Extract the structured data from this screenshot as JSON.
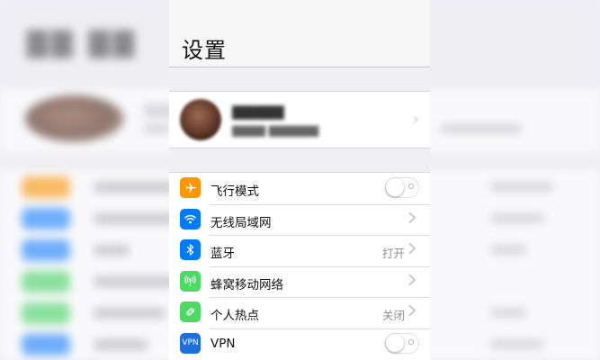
{
  "nav": {
    "title": "设置"
  },
  "colors": {
    "airplane": "#ff9500",
    "wifi": "#007aff",
    "bluetooth": "#007aff",
    "cellular": "#4cd964",
    "hotspot": "#4cd964",
    "vpn": "#1e6fd9",
    "toggle_off": "#ffffff",
    "value_text": "#8e8e93"
  },
  "settings": [
    {
      "label": "飞行模式",
      "icon": "airplane-icon",
      "control": "toggle",
      "on": false
    },
    {
      "label": "无线局域网",
      "icon": "wifi-icon",
      "control": "chevron"
    },
    {
      "label": "蓝牙",
      "icon": "bluetooth-icon",
      "control": "chevron",
      "value": "打开"
    },
    {
      "label": "蜂窝移动网络",
      "icon": "cellular-icon",
      "control": "chevron"
    },
    {
      "label": "个人热点",
      "icon": "hotspot-icon",
      "control": "chevron",
      "value": "关闭"
    },
    {
      "label": "VPN",
      "icon": "vpn-icon",
      "icon_text": "VPN",
      "control": "toggle",
      "on": false
    }
  ]
}
